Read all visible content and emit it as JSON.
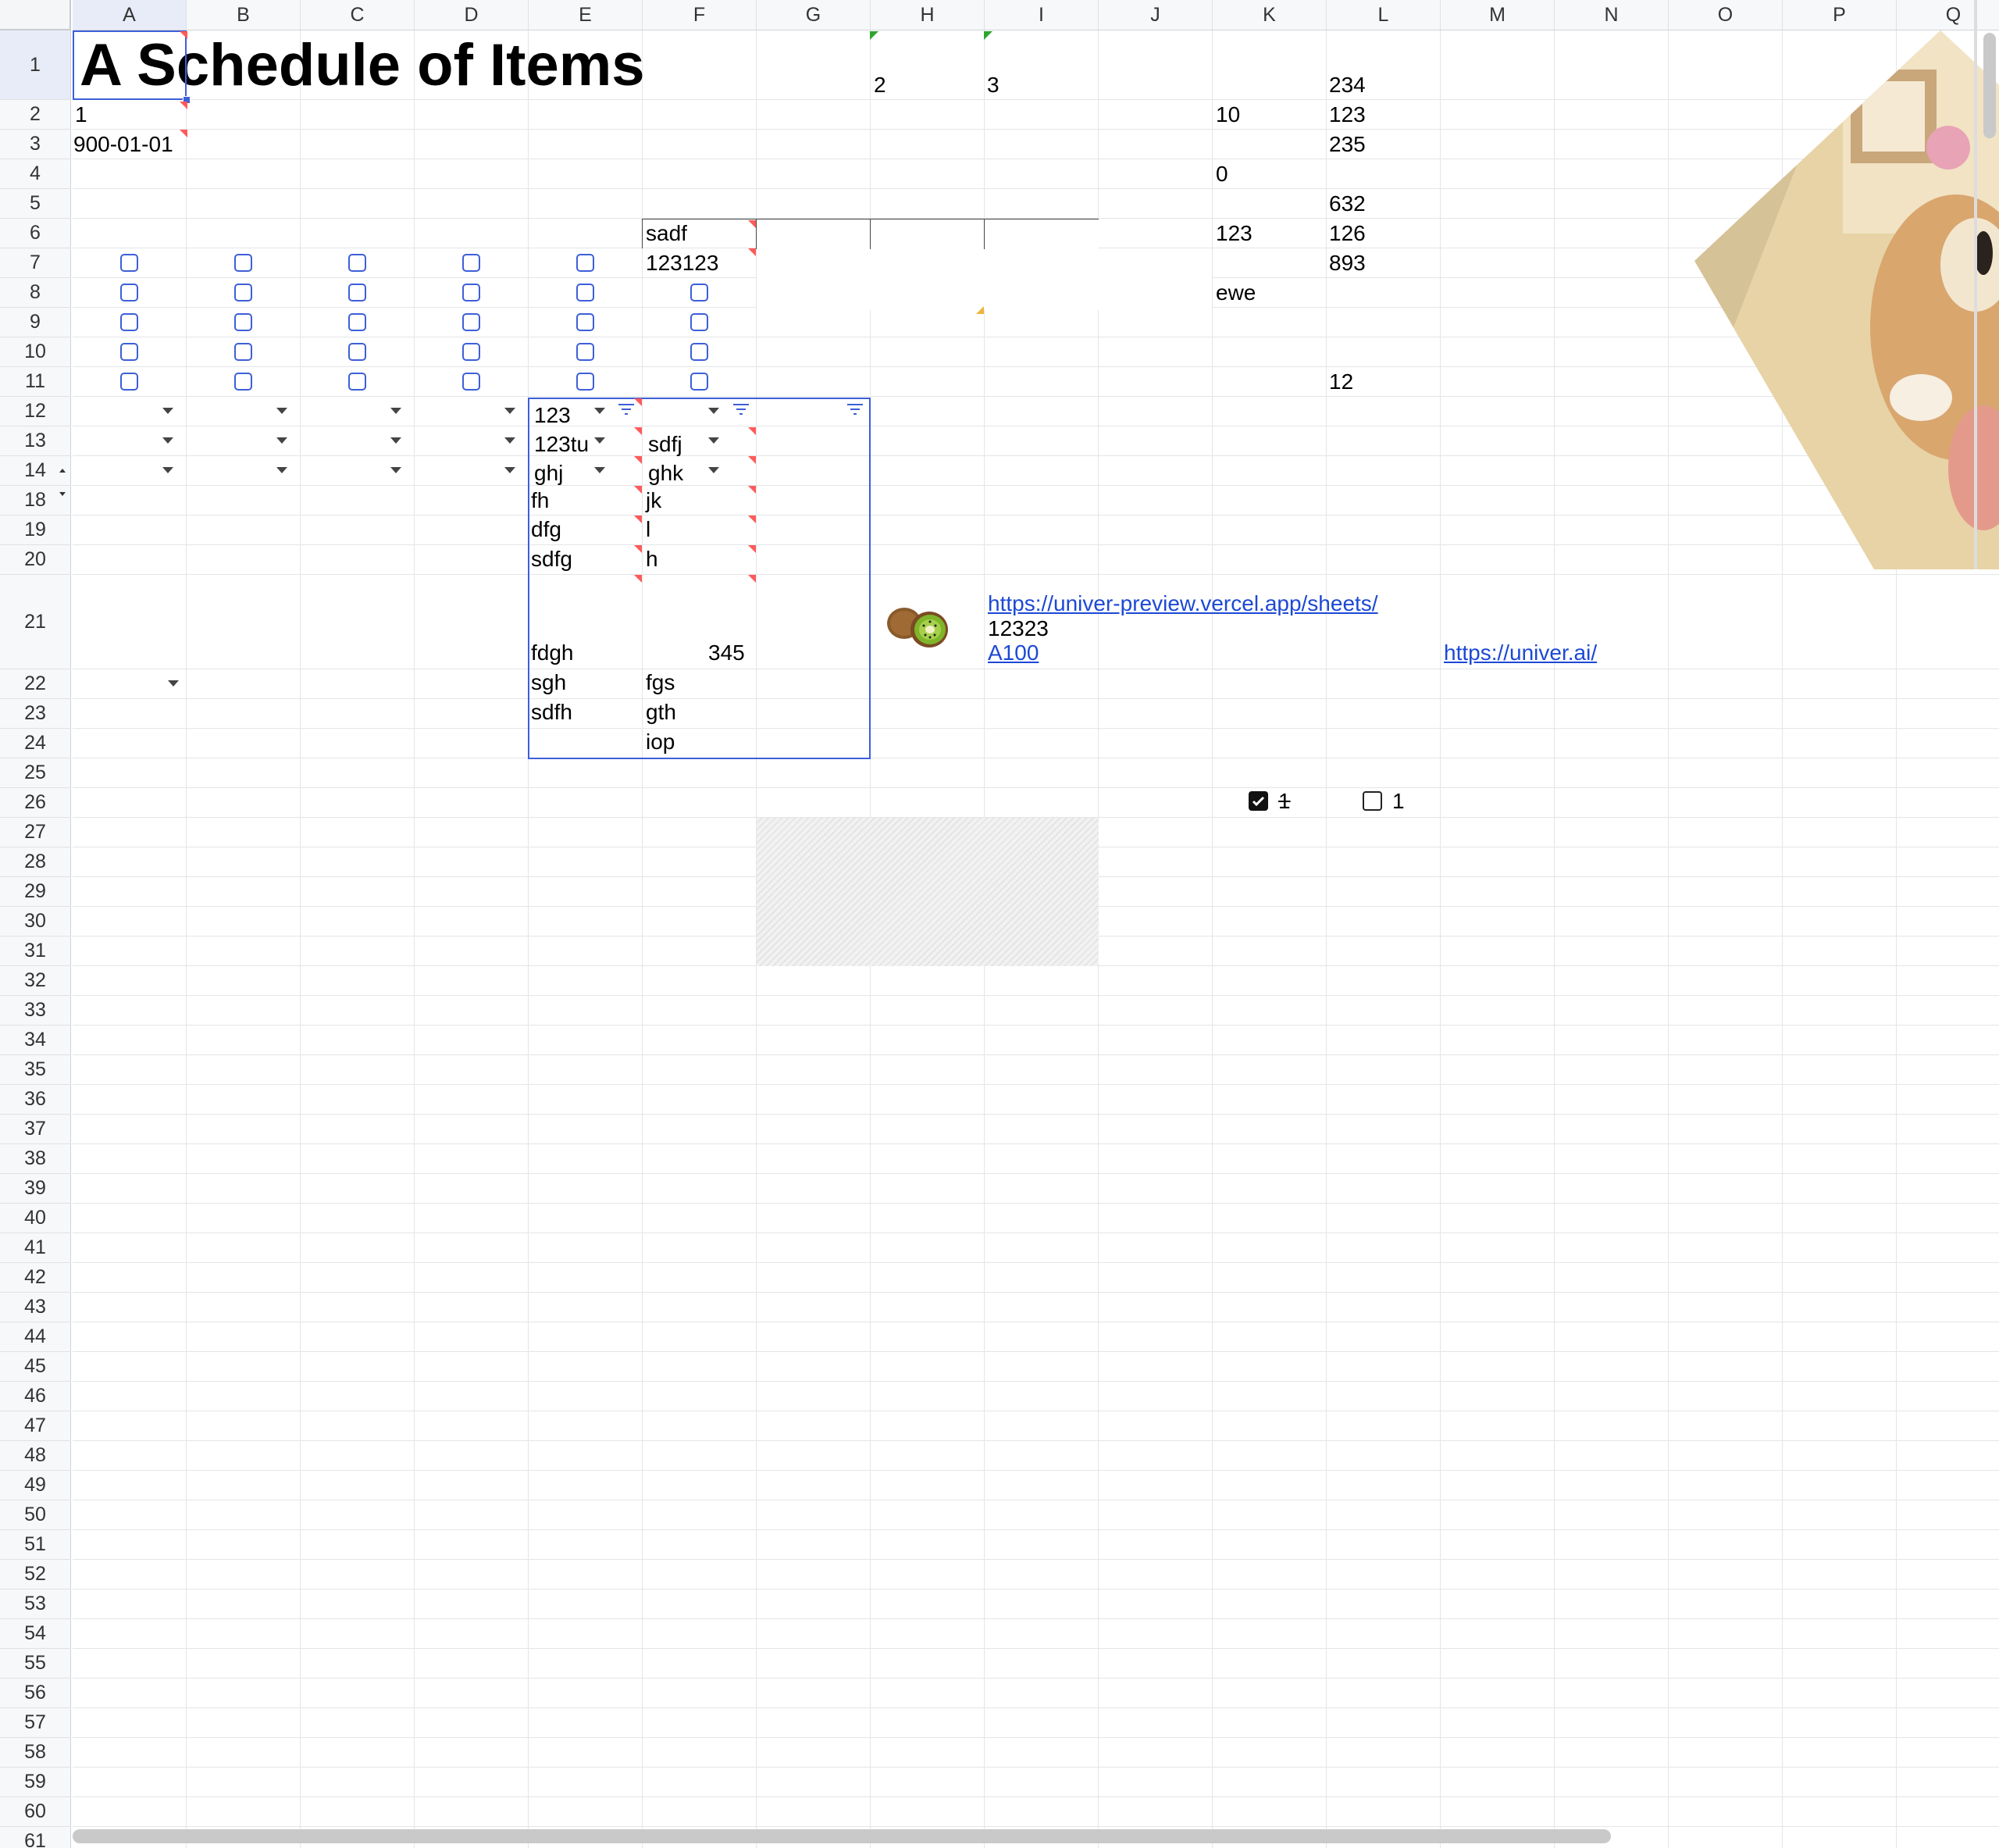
{
  "columns": [
    "A",
    "B",
    "C",
    "D",
    "E",
    "F",
    "G",
    "H",
    "I",
    "J",
    "K",
    "L",
    "M",
    "N",
    "O",
    "P",
    "Q"
  ],
  "rows": [
    "1",
    "2",
    "3",
    "4",
    "5",
    "6",
    "7",
    "8",
    "9",
    "10",
    "11",
    "12",
    "13",
    "14",
    "18",
    "19",
    "20",
    "21",
    "22",
    "23",
    "24",
    "25",
    "26",
    "27",
    "28",
    "29",
    "30",
    "31",
    "32",
    "33",
    "34",
    "35",
    "36",
    "37",
    "38",
    "39",
    "40",
    "41",
    "42",
    "43",
    "44",
    "45",
    "46",
    "47",
    "48",
    "49",
    "50",
    "51",
    "52",
    "53",
    "54",
    "55",
    "56",
    "57",
    "58",
    "59",
    "60",
    "61"
  ],
  "selected_cell": "A1",
  "cells": {
    "A1": "A Schedule of Items",
    "H1": "2",
    "I1": "3",
    "L1": "234",
    "A2": "1",
    "K2": "10",
    "L2": "123",
    "A3": "900-01-01",
    "L3": "235",
    "K4": "0",
    "L5": "632",
    "F6": "sadf",
    "K6": "123",
    "L6": "126",
    "F7": "123123",
    "L7": "893",
    "K8": "ewe",
    "L11": "12",
    "E12": "123",
    "E13": "123tu",
    "F13": "sdfj",
    "E14": "ghj",
    "F14": "ghk",
    "E18": "fh",
    "F18": "jk",
    "E19": "dfg",
    "F19": "l",
    "E20": "sdfg",
    "F20": "h",
    "E21": "fdgh",
    "F21": "345",
    "I21_link": "https://univer-preview.vercel.app/sheets/",
    "I21_text": "12323",
    "I21_link2": "A100",
    "M21_link": "https://univer.ai/",
    "E22": "sgh",
    "F22": "fgs",
    "E23": "sdfh",
    "F23": "gth",
    "F24": "iop",
    "K26_checkbox_label": "1",
    "L26_checkbox_label": "1"
  },
  "checkboxes": {
    "K26_checked": true,
    "L26_checked": false
  },
  "images": {
    "H21": "kiwi-fruit-image",
    "floating": "dog-photo-image"
  },
  "colors": {
    "selection": "#3d5fd8",
    "link": "#1c49d4",
    "comment_marker": "#ff5a5a",
    "green_marker": "#2da52d",
    "orange_marker": "#f0b43a"
  }
}
